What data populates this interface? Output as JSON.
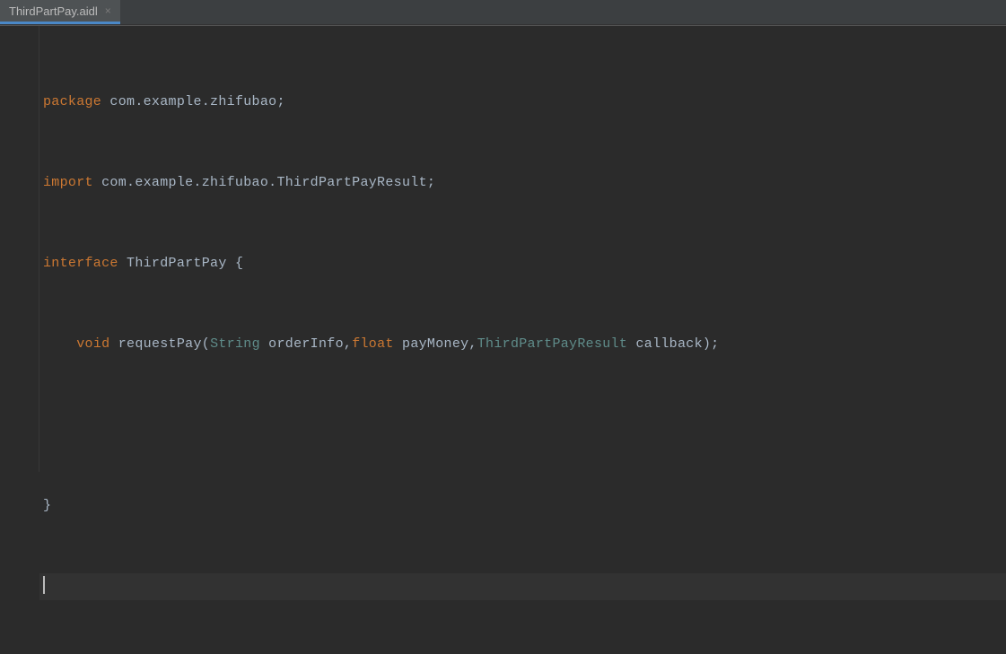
{
  "tab": {
    "title": "ThirdPartPay.aidl",
    "close_glyph": "×"
  },
  "code": {
    "l1": {
      "kw": "package",
      "rest": " com.example.zhifubao;"
    },
    "l2": {
      "kw": "import",
      "rest": " com.example.zhifubao.ThirdPartPayResult;"
    },
    "l3": {
      "kw": "interface",
      "name": " ThirdPartPay ",
      "brace": "{"
    },
    "l4": {
      "indent": "    ",
      "kw": "void",
      "method": " requestPay(",
      "t1": "String",
      "p1": " orderInfo,",
      "t2": "float",
      "p2": " payMoney,",
      "t3": "ThirdPartPayResult",
      "p3": " callback);"
    },
    "l5": "",
    "l6": "}",
    "l7": ""
  }
}
